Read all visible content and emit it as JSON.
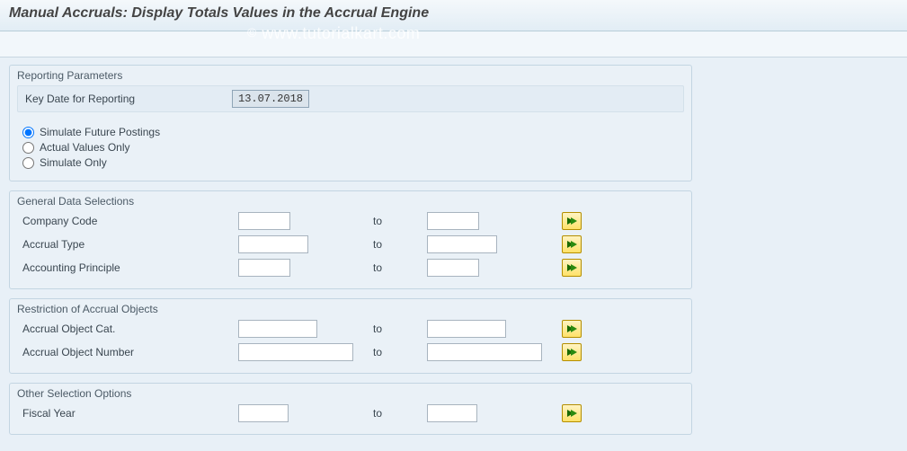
{
  "title": "Manual Accruals: Display Totals Values in the Accrual Engine",
  "watermark": "www.tutorialkart.com",
  "sections": {
    "reporting": {
      "legend": "Reporting Parameters",
      "keydate_label": "Key Date for Reporting",
      "keydate_value": "13.07.2018",
      "radios": {
        "simulate_future": "Simulate Future Postings",
        "actual_only": "Actual Values Only",
        "simulate_only": "Simulate Only"
      }
    },
    "general": {
      "legend": "General Data Selections",
      "rows": [
        {
          "label": "Company Code",
          "from": "",
          "to_label": "to",
          "to": ""
        },
        {
          "label": "Accrual Type",
          "from": "",
          "to_label": "to",
          "to": ""
        },
        {
          "label": "Accounting Principle",
          "from": "",
          "to_label": "to",
          "to": ""
        }
      ]
    },
    "restriction": {
      "legend": "Restriction of Accrual Objects",
      "rows": [
        {
          "label": "Accrual Object Cat.",
          "from": "",
          "to_label": "to",
          "to": ""
        },
        {
          "label": "Accrual Object Number",
          "from": "",
          "to_label": "to",
          "to": ""
        }
      ]
    },
    "other": {
      "legend": "Other Selection Options",
      "rows": [
        {
          "label": "Fiscal Year",
          "from": "",
          "to_label": "to",
          "to": ""
        }
      ]
    }
  }
}
